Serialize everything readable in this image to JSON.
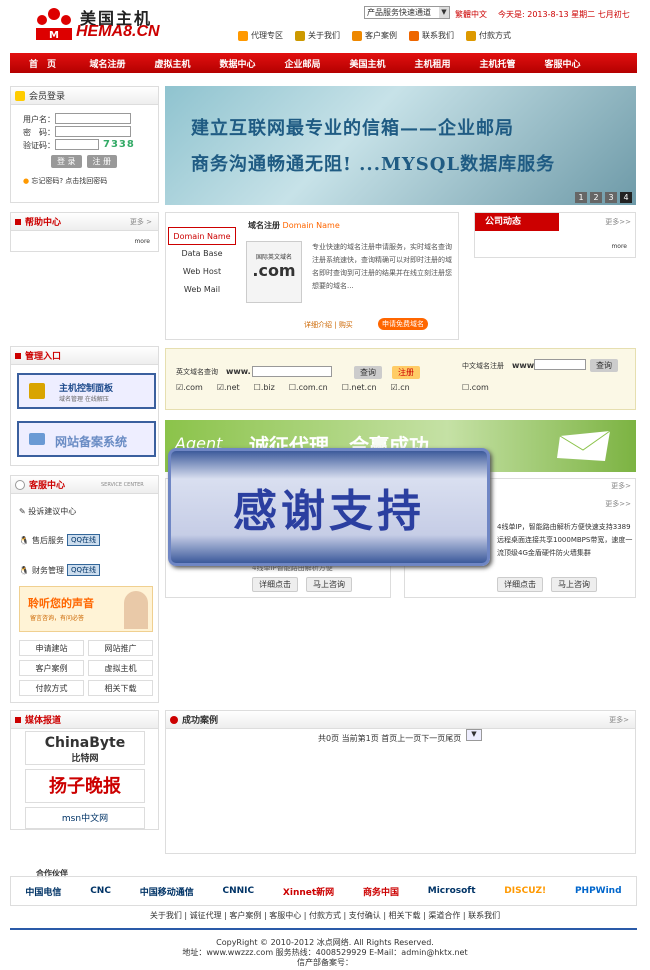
{
  "header": {
    "logo_cn": "美国主机",
    "logo_en": "HEMA8.CN",
    "select": "产品服务快速通道",
    "lang": "繁體中文",
    "date": "今天是: 2013-8-13 星期二 七月初七",
    "links": [
      "代理专区",
      "关于我们",
      "客户案例",
      "联系我们",
      "付款方式"
    ]
  },
  "nav": [
    "首　页",
    "域名注册",
    "虚拟主机",
    "数据中心",
    "企业邮局",
    "美国主机",
    "主机租用",
    "主机托管",
    "客服中心"
  ],
  "login": {
    "title": "会员登录",
    "user": "用户名：",
    "pass": "密　码：",
    "code": "验证码：",
    "codeval": "7338",
    "login_btn": "登 录",
    "reg_btn": "注 册",
    "forgot": "忘记密码? 点击找回密码"
  },
  "banner": {
    "line1": "建立互联网最专业的信箱——企业邮局",
    "line2": "商务沟通畅通无阻! ...MYSQL数据库服务",
    "pages": [
      "1",
      "2",
      "3",
      "4"
    ]
  },
  "help": {
    "title": "帮助中心",
    "more": "更多 >",
    "inner": "more"
  },
  "domain": {
    "tabs": [
      "Domain Name",
      "Data Base",
      "Web Host",
      "Web Mail"
    ],
    "title": "域名注册",
    "title_en": "Domain Name",
    "logo_top": "国际英文域名",
    "logo_main": ".com",
    "desc": "专业快速的域名注册申请服务，实时域名查询注册系统速快，查询精确可以对即时注册的域名即时查询到可注册的结果并在线立刻注册您想要的域名...",
    "link1": "详细介绍",
    "link2": "购买",
    "btn": "申请免费域名"
  },
  "company": {
    "title": "公司动态",
    "more": "更多>>",
    "inner": "more"
  },
  "admin": {
    "title": "管理入口",
    "panel": "主机控制面板",
    "panel_sub": "域名管理 在线解压",
    "record": "网站备案系统"
  },
  "search": {
    "en_label": "英文域名查询",
    "www": "www.",
    "query": "查询",
    "reg": "注册",
    "cn_label": "中文域名注册",
    "www2": "www.",
    "query2": "查询",
    "tlds": [
      ".com",
      ".net",
      ".biz",
      ".com.cn",
      ".net.cn",
      ".cn"
    ],
    "cn_tld": ".com"
  },
  "green": {
    "text1": "Agent",
    "text2": "诚征代理，合赢成功"
  },
  "service": {
    "title": "客服中心",
    "sub": "SERVICE CENTER",
    "complain": "投诉建议中心",
    "sales": "售后服务",
    "finance": "财务管理",
    "qq": "QQ在线",
    "voice": "聆听您的声音",
    "voice_sub": "留言咨询，有问必答",
    "links": [
      "申请建站",
      "网站推广",
      "客户案例",
      "虚拟主机",
      "付款方式",
      "相关下载"
    ]
  },
  "mid": {
    "more1": "更多>",
    "more2": "更多>>",
    "desc_right": "4线单IP，智能路由解析方便快速支持3389远程桌面连接共享1000MBPS带宽，速度一流顶级4G金盾硬件防火墙集群",
    "desc_left": "4线单IP智能路由解析方便",
    "detail": "详细点击",
    "consult": "马上咨询",
    "detail2": "详细点击",
    "consult2": "马上咨询"
  },
  "overlay": "感谢支持",
  "media": {
    "title": "媒体报道",
    "l1": "ChinaByte",
    "l1b": "比特网",
    "l2": "扬子晚报",
    "l3": "msn中文网"
  },
  "cases": {
    "title": "成功案例",
    "more": "更多>",
    "pager": "共0页 当前第1页 首页上一页下一页尾页"
  },
  "partners": {
    "title": "合作伙伴",
    "items": [
      "中国电信",
      "CNC",
      "中国移动通信",
      "CNNIC",
      "Xinnet新网",
      "商务中国",
      "Microsoft",
      "DISCUZ!",
      "PHPWind"
    ]
  },
  "footer": {
    "links": "关于我们 | 诚征代理 | 客户案例 | 客服中心 | 付款方式 | 支付确认 | 相关下载 | 渠道合作 | 联系我们",
    "copy": "CopyRight © 2010-2012 冰点网络. All Rights Reserved.",
    "addr": "地址：www.wwzzz.com 服务热线：4008529929 E-Mail：admin@hktx.net",
    "icp": "信产部备案号："
  }
}
